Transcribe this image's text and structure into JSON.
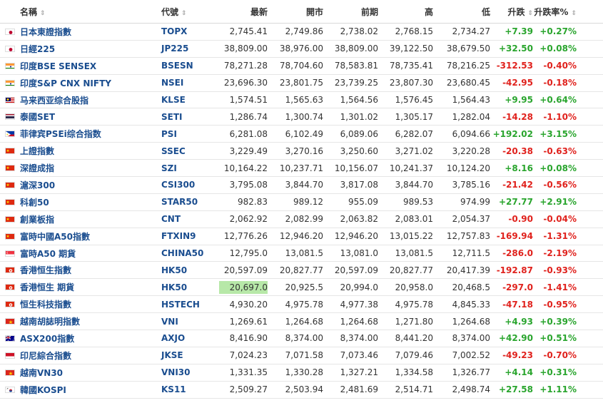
{
  "columns": {
    "name": "名稱",
    "symbol": "代號",
    "last": "最新",
    "open": "開市",
    "prev": "前期",
    "high": "高",
    "low": "低",
    "change": "升跌",
    "pct": "升跌率%"
  },
  "rows": [
    {
      "flag": "jp",
      "name": "日本東證指數",
      "symbol": "TOPX",
      "last": "2,745.41",
      "open": "2,749.86",
      "prev": "2,738.02",
      "high": "2,768.15",
      "low": "2,734.27",
      "change": "+7.39",
      "pct": "+0.27%",
      "dir": "up"
    },
    {
      "flag": "jp",
      "name": "日經225",
      "symbol": "JP225",
      "last": "38,809.00",
      "open": "38,976.00",
      "prev": "38,809.00",
      "high": "39,122.50",
      "low": "38,679.50",
      "change": "+32.50",
      "pct": "+0.08%",
      "dir": "up"
    },
    {
      "flag": "in",
      "name": "印度BSE SENSEX",
      "symbol": "BSESN",
      "last": "78,271.28",
      "open": "78,704.60",
      "prev": "78,583.81",
      "high": "78,735.41",
      "low": "78,216.25",
      "change": "-312.53",
      "pct": "-0.40%",
      "dir": "down"
    },
    {
      "flag": "in",
      "name": "印度S&P CNX NIFTY",
      "symbol": "NSEI",
      "last": "23,696.30",
      "open": "23,801.75",
      "prev": "23,739.25",
      "high": "23,807.30",
      "low": "23,680.45",
      "change": "-42.95",
      "pct": "-0.18%",
      "dir": "down"
    },
    {
      "flag": "my",
      "name": "马来西亚综合股指",
      "symbol": "KLSE",
      "last": "1,574.51",
      "open": "1,565.63",
      "prev": "1,564.56",
      "high": "1,576.45",
      "low": "1,564.43",
      "change": "+9.95",
      "pct": "+0.64%",
      "dir": "up"
    },
    {
      "flag": "th",
      "name": "泰國SET",
      "symbol": "SETI",
      "last": "1,286.74",
      "open": "1,300.74",
      "prev": "1,301.02",
      "high": "1,305.17",
      "low": "1,282.04",
      "change": "-14.28",
      "pct": "-1.10%",
      "dir": "down"
    },
    {
      "flag": "ph",
      "name": "菲律宾PSEi综合指数",
      "symbol": "PSI",
      "last": "6,281.08",
      "open": "6,102.49",
      "prev": "6,089.06",
      "high": "6,282.07",
      "low": "6,094.66",
      "change": "+192.02",
      "pct": "+3.15%",
      "dir": "up"
    },
    {
      "flag": "cn",
      "name": "上證指數",
      "symbol": "SSEC",
      "last": "3,229.49",
      "open": "3,270.16",
      "prev": "3,250.60",
      "high": "3,271.02",
      "low": "3,220.28",
      "change": "-20.38",
      "pct": "-0.63%",
      "dir": "down"
    },
    {
      "flag": "cn",
      "name": "深證成指",
      "symbol": "SZI",
      "last": "10,164.22",
      "open": "10,237.71",
      "prev": "10,156.07",
      "high": "10,241.37",
      "low": "10,124.20",
      "change": "+8.16",
      "pct": "+0.08%",
      "dir": "up"
    },
    {
      "flag": "cn",
      "name": "滬深300",
      "symbol": "CSI300",
      "last": "3,795.08",
      "open": "3,844.70",
      "prev": "3,817.08",
      "high": "3,844.70",
      "low": "3,785.16",
      "change": "-21.42",
      "pct": "-0.56%",
      "dir": "down"
    },
    {
      "flag": "cn",
      "name": "科創50",
      "symbol": "STAR50",
      "last": "982.83",
      "open": "989.12",
      "prev": "955.09",
      "high": "989.53",
      "low": "974.99",
      "change": "+27.77",
      "pct": "+2.91%",
      "dir": "up"
    },
    {
      "flag": "cn",
      "name": "創業板指",
      "symbol": "CNT",
      "last": "2,062.92",
      "open": "2,082.99",
      "prev": "2,063.82",
      "high": "2,083.01",
      "low": "2,054.37",
      "change": "-0.90",
      "pct": "-0.04%",
      "dir": "down"
    },
    {
      "flag": "cn",
      "name": "富時中國A50指數",
      "symbol": "FTXIN9",
      "last": "12,776.26",
      "open": "12,946.20",
      "prev": "12,946.20",
      "high": "13,015.22",
      "low": "12,757.83",
      "change": "-169.94",
      "pct": "-1.31%",
      "dir": "down"
    },
    {
      "flag": "sg",
      "name": "富時A50 期貨",
      "symbol": "CHINA50",
      "last": "12,795.0",
      "open": "13,081.5",
      "prev": "13,081.0",
      "high": "13,081.5",
      "low": "12,711.5",
      "change": "-286.0",
      "pct": "-2.19%",
      "dir": "down"
    },
    {
      "flag": "hk",
      "name": "香港恒生指數",
      "symbol": "HK50",
      "last": "20,597.09",
      "open": "20,827.77",
      "prev": "20,597.09",
      "high": "20,827.77",
      "low": "20,417.39",
      "change": "-192.87",
      "pct": "-0.93%",
      "dir": "down"
    },
    {
      "flag": "hk",
      "name": "香港恒生 期貨",
      "symbol": "HK50",
      "last": "20,697.0",
      "open": "20,925.5",
      "prev": "20,994.0",
      "high": "20,958.0",
      "low": "20,468.5",
      "change": "-297.0",
      "pct": "-1.41%",
      "dir": "down",
      "highlight": true
    },
    {
      "flag": "hk",
      "name": "恒生科技指數",
      "symbol": "HSTECH",
      "last": "4,930.20",
      "open": "4,975.78",
      "prev": "4,977.38",
      "high": "4,975.78",
      "low": "4,845.33",
      "change": "-47.18",
      "pct": "-0.95%",
      "dir": "down"
    },
    {
      "flag": "vn",
      "name": "越南胡誌明指數",
      "symbol": "VNI",
      "last": "1,269.61",
      "open": "1,264.68",
      "prev": "1,264.68",
      "high": "1,271.80",
      "low": "1,264.68",
      "change": "+4.93",
      "pct": "+0.39%",
      "dir": "up"
    },
    {
      "flag": "au",
      "name": "ASX200指數",
      "symbol": "AXJO",
      "last": "8,416.90",
      "open": "8,374.00",
      "prev": "8,374.00",
      "high": "8,441.20",
      "low": "8,374.00",
      "change": "+42.90",
      "pct": "+0.51%",
      "dir": "up"
    },
    {
      "flag": "id",
      "name": "印尼綜合指數",
      "symbol": "JKSE",
      "last": "7,024.23",
      "open": "7,071.58",
      "prev": "7,073.46",
      "high": "7,079.46",
      "low": "7,002.52",
      "change": "-49.23",
      "pct": "-0.70%",
      "dir": "down"
    },
    {
      "flag": "vn",
      "name": "越南VN30",
      "symbol": "VNI30",
      "last": "1,331.35",
      "open": "1,330.28",
      "prev": "1,327.21",
      "high": "1,334.58",
      "low": "1,326.77",
      "change": "+4.14",
      "pct": "+0.31%",
      "dir": "up"
    },
    {
      "flag": "kr",
      "name": "韓國KOSPI",
      "symbol": "KS11",
      "last": "2,509.27",
      "open": "2,503.94",
      "prev": "2,481.69",
      "high": "2,514.71",
      "low": "2,498.74",
      "change": "+27.58",
      "pct": "+1.11%",
      "dir": "up"
    }
  ],
  "colors": {
    "up": "#2aa52e",
    "down": "#e0221d",
    "link": "#1a4d8f",
    "highlight": "#b7e8a8"
  }
}
